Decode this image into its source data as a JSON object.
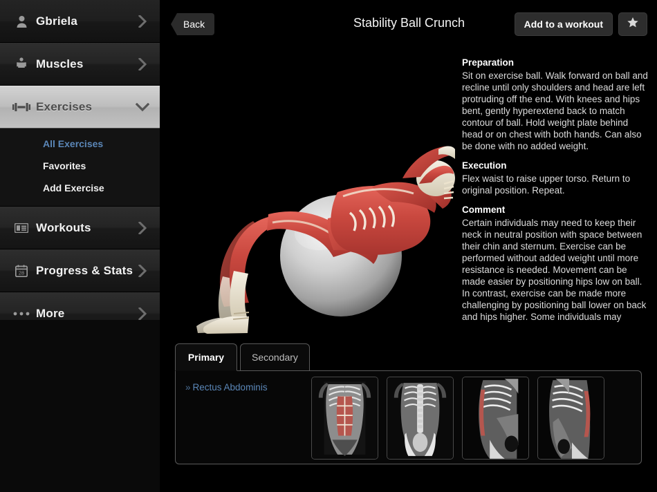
{
  "sidebar": {
    "user": {
      "name": "Gbriela",
      "icon": "person-icon",
      "chevron": "chevron-right-icon"
    },
    "items": [
      {
        "label": "Muscles",
        "icon": "torso-icon",
        "chevron": "chevron-right-icon",
        "state": "collapsed"
      },
      {
        "label": "Exercises",
        "icon": "dumbbell-icon",
        "chevron": "chevron-down-icon",
        "state": "expanded"
      },
      {
        "label": "Workouts",
        "icon": "list-card-icon",
        "chevron": "chevron-right-icon",
        "state": "collapsed"
      },
      {
        "label": "Progress & Stats",
        "icon": "calendar-icon",
        "chevron": "chevron-right-icon",
        "state": "collapsed"
      },
      {
        "label": "More",
        "icon": "ellipsis-icon",
        "chevron": "chevron-right-icon",
        "state": "collapsed"
      }
    ],
    "sub_items": [
      {
        "label": "All Exercises",
        "selected": true
      },
      {
        "label": "Favorites",
        "selected": false
      },
      {
        "label": "Add Exercise",
        "selected": false
      }
    ],
    "selected_color": "#5b87b8",
    "active_row_color": "#c2c2c2"
  },
  "header": {
    "back_label": "Back",
    "title": "Stability Ball Crunch",
    "add_to_workout_label": "Add to a workout",
    "favorite_icon": "star-icon"
  },
  "exercise": {
    "figure_alt": "anatomical-figure-on-stability-ball",
    "sections": [
      {
        "heading": "Preparation",
        "body": "Sit on exercise ball. Walk forward on ball and recline until only shoulders and head are left protruding off the end. With knees and hips bent, gently hyperextend back to match contour of ball. Hold weight plate behind head or on chest with both hands. Can also be done with no added weight."
      },
      {
        "heading": "Execution",
        "body": "Flex waist to raise upper torso. Return to original position. Repeat."
      },
      {
        "heading": "Comment",
        "body": "Certain individuals may need to keep their neck in neutral position with space between their chin and sternum. Exercise can be performed without added weight until more resistance is needed. Movement can be made easier by positioning hips low on ball. In contrast, exercise can be made more challenging by positioning ball lower on back and hips higher. Some individuals may"
      }
    ]
  },
  "muscles_panel": {
    "tabs": [
      {
        "label": "Primary",
        "active": true
      },
      {
        "label": "Secondary",
        "active": false
      }
    ],
    "muscle_links": [
      {
        "prefix": "»",
        "label": "Rectus Abdominis"
      }
    ],
    "thumbnails": [
      {
        "name": "anterior-abdomen-view",
        "highlight": "#b44"
      },
      {
        "name": "posterior-abdomen-view",
        "highlight": "none"
      },
      {
        "name": "lateral-left-abdomen-view",
        "highlight": "#b44"
      },
      {
        "name": "lateral-right-abdomen-view",
        "highlight": "#b44"
      }
    ]
  }
}
